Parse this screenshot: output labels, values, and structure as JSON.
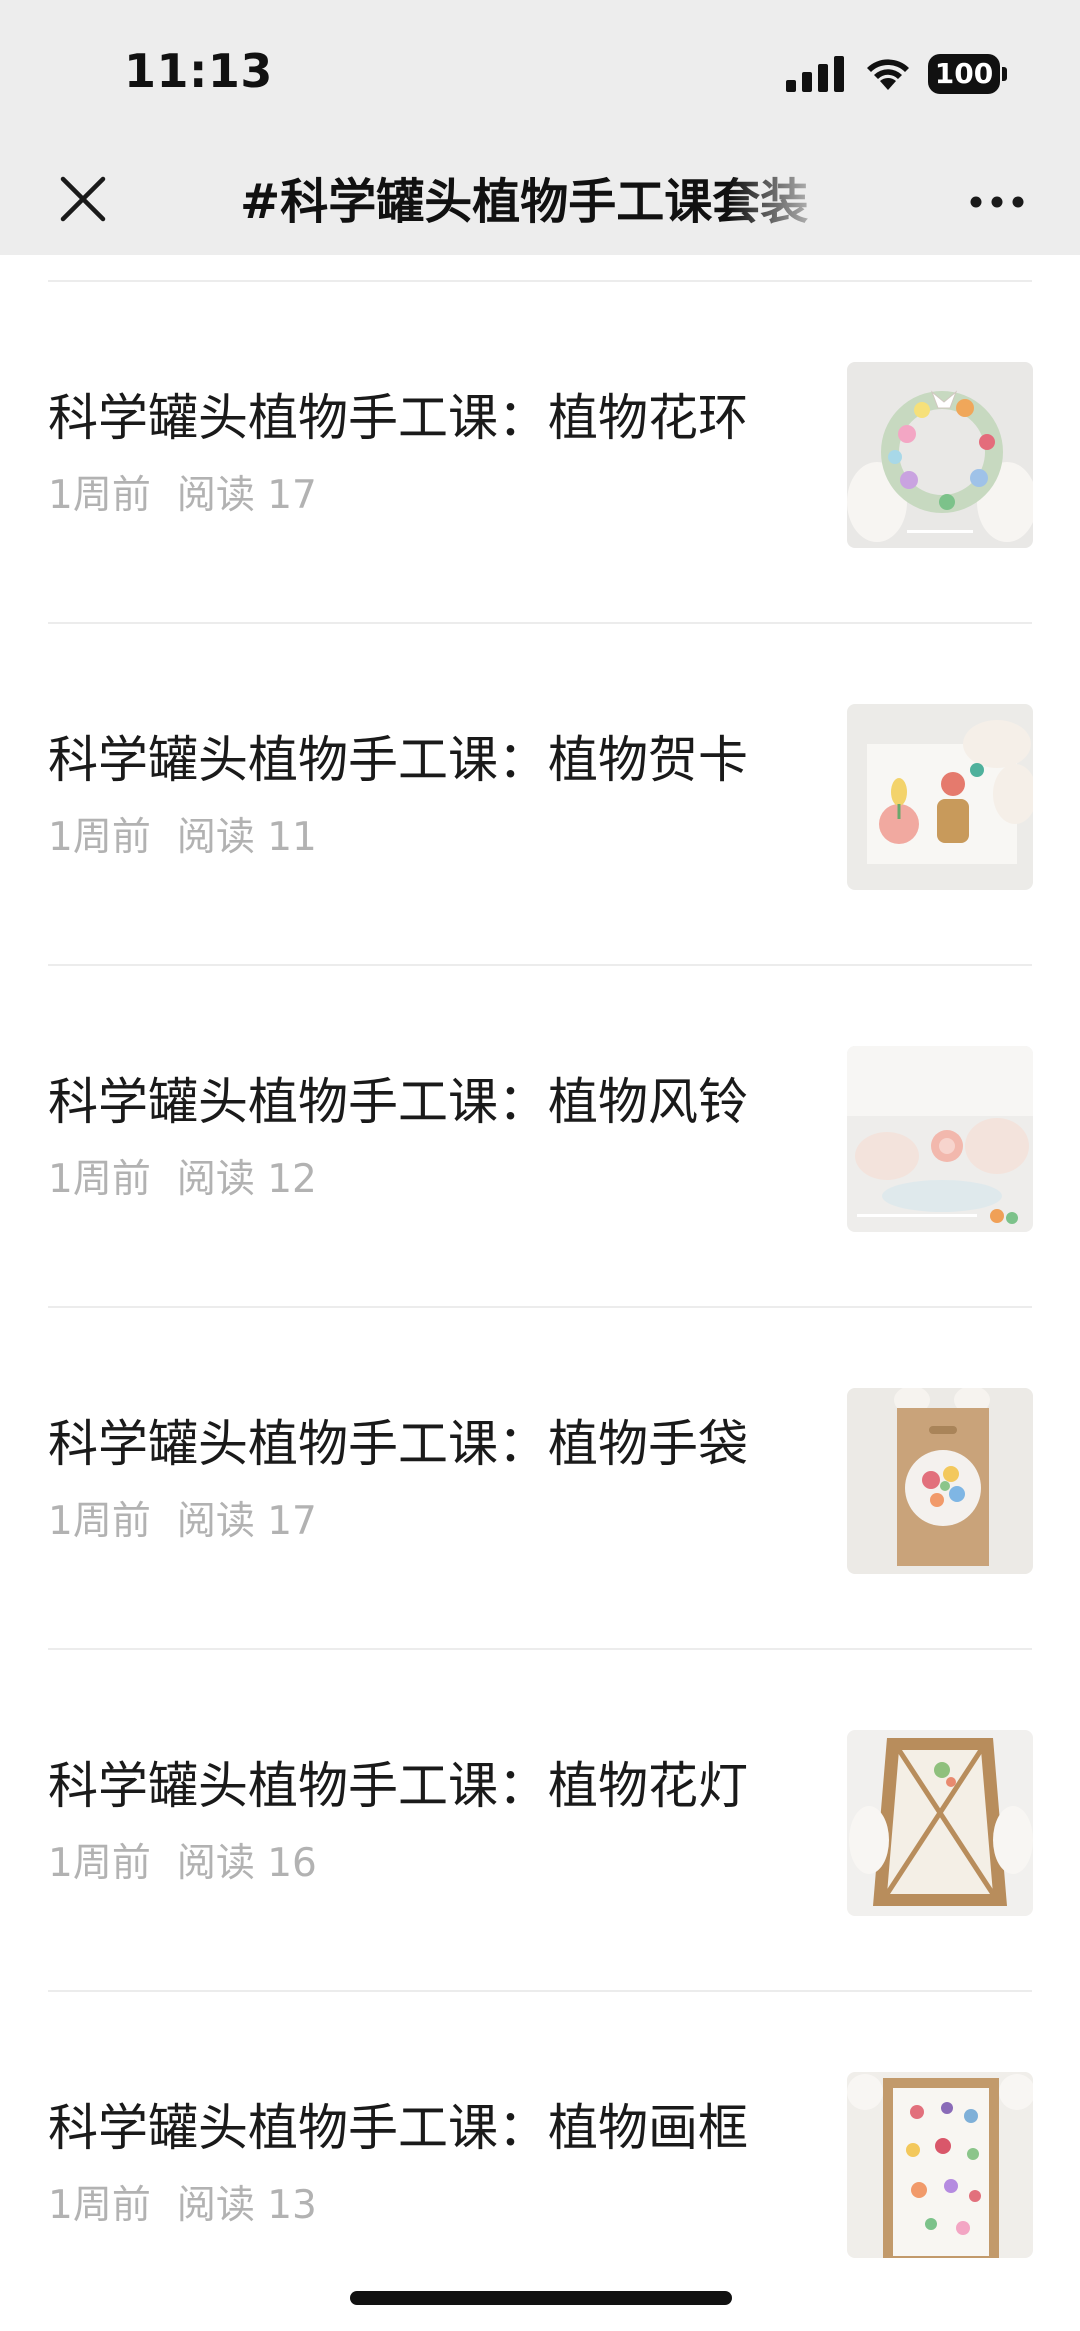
{
  "status_bar": {
    "time": "11:13",
    "battery": "100"
  },
  "nav": {
    "title": "#科学罐头植物手工课套装",
    "close_icon": "close-icon",
    "more_icon": "more-icon"
  },
  "articles": [
    {
      "title": "科学罐头植物手工课：植物花环",
      "time": "1周前",
      "reads": "阅读 17"
    },
    {
      "title": "科学罐头植物手工课：植物贺卡",
      "time": "1周前",
      "reads": "阅读 11"
    },
    {
      "title": "科学罐头植物手工课：植物风铃",
      "time": "1周前",
      "reads": "阅读 12"
    },
    {
      "title": "科学罐头植物手工课：植物手袋",
      "time": "1周前",
      "reads": "阅读 17"
    },
    {
      "title": "科学罐头植物手工课：植物花灯",
      "time": "1周前",
      "reads": "阅读 16"
    },
    {
      "title": "科学罐头植物手工课：植物画框",
      "time": "1周前",
      "reads": "阅读 13"
    }
  ],
  "colors": {
    "nav_bg": "#ededed",
    "meta_text": "#b2b2b2",
    "divider": "#ececec"
  }
}
